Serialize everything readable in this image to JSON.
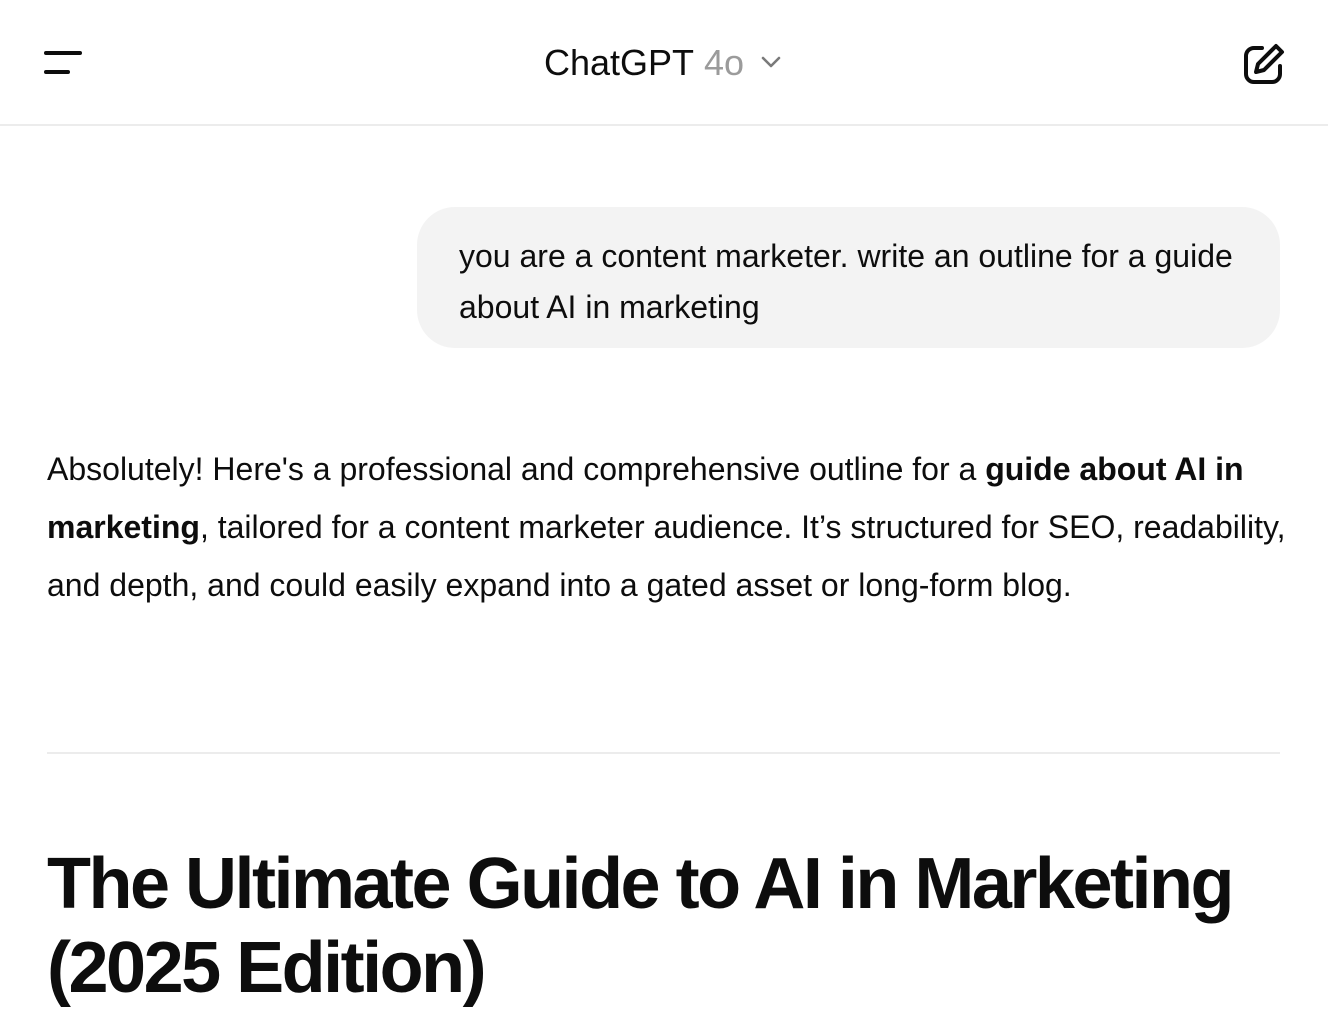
{
  "header": {
    "title": "ChatGPT",
    "model": "4o"
  },
  "conversation": {
    "user_message": "you are a content marketer. write an outline for a guide about AI in marketing",
    "assistant": {
      "intro_1": "Absolutely! Here's a professional and comprehensive outline for a ",
      "intro_bold": "guide about AI in marketing",
      "intro_2": ", tailored for a content marketer audience. It’s structured for SEO, readability, and depth, and could easily expand into a gated asset or long-form blog.",
      "heading": "The Ultimate Guide to AI in Marketing (2025 Edition)"
    }
  },
  "icons": {
    "menu": "sidebar-menu-icon",
    "chevron": "chevron-down-icon",
    "compose": "new-chat-icon"
  }
}
